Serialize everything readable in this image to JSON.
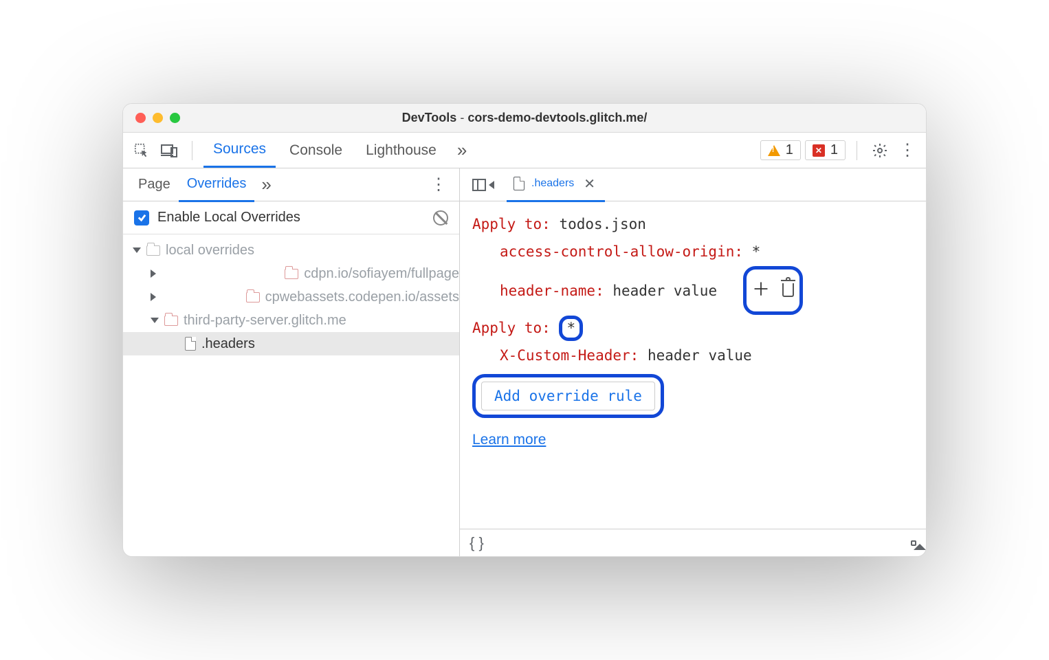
{
  "title": {
    "app": "DevTools",
    "sep": " - ",
    "url": "cors-demo-devtools.glitch.me/"
  },
  "toolbar": {
    "tabs": [
      "Sources",
      "Console",
      "Lighthouse"
    ],
    "active": "Sources",
    "more": "»",
    "warning_count": "1",
    "error_count": "1"
  },
  "left": {
    "tabs": [
      "Page",
      "Overrides"
    ],
    "active": "Overrides",
    "more": "»",
    "enable_label": "Enable Local Overrides",
    "tree": {
      "root": "local overrides",
      "children": [
        "cdpn.io/sofiayem/fullpage",
        "cpwebassets.codepen.io/assets",
        "third-party-server.glitch.me"
      ],
      "file": ".headers"
    }
  },
  "right": {
    "tab_file": ".headers",
    "rules": [
      {
        "apply_label": "Apply to",
        "apply_value": "todos.json",
        "headers": [
          {
            "name": "access-control-allow-origin",
            "value": "*"
          },
          {
            "name": "header-name",
            "value": "header value"
          }
        ]
      },
      {
        "apply_label": "Apply to",
        "apply_value": "*",
        "headers": [
          {
            "name": "X-Custom-Header",
            "value": "header value"
          }
        ]
      }
    ],
    "add_button": "Add override rule",
    "learn": "Learn more",
    "braces": "{ }"
  }
}
